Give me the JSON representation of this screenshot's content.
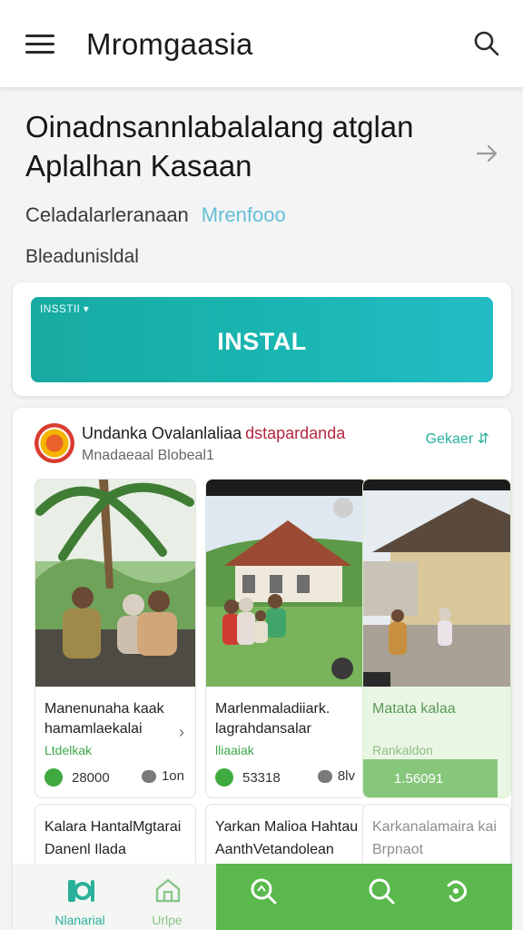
{
  "app_bar": {
    "title": "Mromgaasia",
    "menu_icon": "menu-icon",
    "search_icon": "search-icon"
  },
  "hero": {
    "headline": "Oinadnsannlabalalang atglan Aplalhan Kasaan",
    "meta_text": "Celadalarleranaan",
    "meta_link": "Mrenfooo",
    "sub_text": "Bleadunisldal"
  },
  "install": {
    "tag": "INSSTII ▾",
    "label": "INSTAL"
  },
  "feed": {
    "title": "Undanka Ovalanlaliaa",
    "title_accent": "dstapardanda",
    "subtitle": "Mnadaeaal Blobeal1",
    "action": "Gekaer ⇵",
    "tiles": [
      {
        "title": "Manenunaha kaak hamamlaekalai",
        "tag": "Ltdelkak",
        "likes": "28000",
        "comments": "1on"
      },
      {
        "title": "Marlenmaladiiark. lagrahdansalar",
        "tag": "lliaaiak",
        "likes": "53318",
        "comments": "8lv"
      },
      {
        "title": "Matata kalaa",
        "tag": "Rankaldon",
        "likes": "1.56091",
        "comments": ""
      }
    ],
    "second_row": [
      {
        "text": "Kalara HantalMgtarai Danenl Ilada"
      },
      {
        "text": "Yarkan Malioa Hahtau AanthVetandolean"
      },
      {
        "text": "Karkanalamaira kai Brpnaot"
      }
    ]
  },
  "bottom_nav": {
    "items": [
      {
        "label": "Nlanarial",
        "icon": "home-grid-icon"
      },
      {
        "label": "Urlpe",
        "icon": "house-icon"
      },
      {
        "label": "",
        "icon": "search-icon"
      },
      {
        "label": "",
        "icon": "search-icon"
      },
      {
        "label": "",
        "icon": "settings-icon"
      }
    ]
  },
  "colors": {
    "accent_teal": "#1ab7b4",
    "accent_green": "#5ab84c",
    "link_blue": "#66bfd6",
    "accent_red": "#b2263f"
  }
}
